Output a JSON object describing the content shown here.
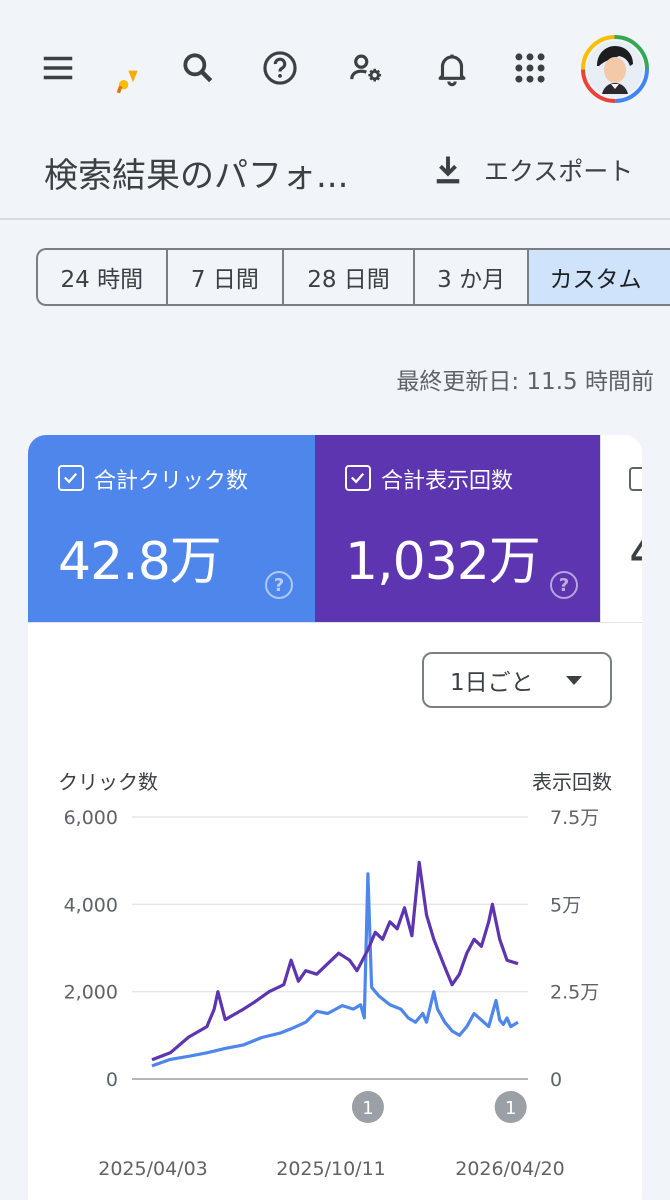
{
  "toolbar": {
    "icons": [
      "menu-icon",
      "search-console-logo",
      "search-icon",
      "help-icon",
      "manage-users-icon",
      "notifications-icon",
      "apps-icon",
      "account-avatar"
    ]
  },
  "header": {
    "title": "検索結果のパフォ...",
    "export_label": "エクスポート"
  },
  "date_range": {
    "tabs": [
      {
        "label": "24 時間",
        "active": false
      },
      {
        "label": "7 日間",
        "active": false
      },
      {
        "label": "28 日間",
        "active": false
      },
      {
        "label": "3 か月",
        "active": false
      },
      {
        "label": "カスタム",
        "active": true
      }
    ]
  },
  "last_updated": "最終更新日: 11.5 時間前",
  "metrics": [
    {
      "label": "合計クリック数",
      "value": "42.8万",
      "checked": true,
      "color": "#4f86ec"
    },
    {
      "label": "合計表示回数",
      "value": "1,032万",
      "checked": true,
      "color": "#5e35b1"
    },
    {
      "label": "",
      "value": "4",
      "checked": false
    }
  ],
  "granularity": {
    "selected": "1日ごと"
  },
  "chart_data": {
    "type": "line",
    "left_axis": {
      "label": "クリック数",
      "ticks": [
        "6,000",
        "4,000",
        "2,000",
        "0"
      ],
      "ylim": [
        0,
        6000
      ]
    },
    "right_axis": {
      "label": "表示回数",
      "ticks": [
        "7.5万",
        "5万",
        "2.5万",
        "0"
      ],
      "ylim": [
        0,
        75000
      ]
    },
    "x_ticks": [
      "2025/04/03",
      "2025/10/11",
      "2026/04/20"
    ],
    "x_range": [
      0,
      1
    ],
    "annotations": [
      {
        "text": "1",
        "x": 0.59
      },
      {
        "text": "1",
        "x": 0.98
      }
    ],
    "series": [
      {
        "name": "合計クリック数",
        "axis": "left",
        "color": "#4f86ec",
        "points": [
          [
            0.0,
            300
          ],
          [
            0.05,
            450
          ],
          [
            0.1,
            520
          ],
          [
            0.15,
            600
          ],
          [
            0.2,
            700
          ],
          [
            0.25,
            780
          ],
          [
            0.3,
            950
          ],
          [
            0.35,
            1050
          ],
          [
            0.38,
            1150
          ],
          [
            0.42,
            1300
          ],
          [
            0.45,
            1550
          ],
          [
            0.48,
            1500
          ],
          [
            0.52,
            1680
          ],
          [
            0.55,
            1600
          ],
          [
            0.57,
            1700
          ],
          [
            0.58,
            1400
          ],
          [
            0.59,
            4700
          ],
          [
            0.6,
            2100
          ],
          [
            0.62,
            1900
          ],
          [
            0.65,
            1700
          ],
          [
            0.68,
            1600
          ],
          [
            0.7,
            1400
          ],
          [
            0.72,
            1300
          ],
          [
            0.74,
            1500
          ],
          [
            0.75,
            1300
          ],
          [
            0.77,
            2000
          ],
          [
            0.78,
            1600
          ],
          [
            0.8,
            1300
          ],
          [
            0.82,
            1100
          ],
          [
            0.84,
            1000
          ],
          [
            0.86,
            1200
          ],
          [
            0.88,
            1500
          ],
          [
            0.9,
            1350
          ],
          [
            0.92,
            1200
          ],
          [
            0.94,
            1800
          ],
          [
            0.95,
            1350
          ],
          [
            0.96,
            1250
          ],
          [
            0.97,
            1400
          ],
          [
            0.98,
            1200
          ],
          [
            1.0,
            1300
          ]
        ]
      },
      {
        "name": "合計表示回数",
        "axis": "right",
        "color": "#5e35b1",
        "points": [
          [
            0.0,
            5500
          ],
          [
            0.05,
            7500
          ],
          [
            0.1,
            12000
          ],
          [
            0.15,
            15000
          ],
          [
            0.17,
            20000
          ],
          [
            0.18,
            25000
          ],
          [
            0.2,
            17000
          ],
          [
            0.25,
            20000
          ],
          [
            0.28,
            22000
          ],
          [
            0.32,
            25000
          ],
          [
            0.36,
            27000
          ],
          [
            0.38,
            34000
          ],
          [
            0.4,
            28000
          ],
          [
            0.42,
            31000
          ],
          [
            0.45,
            30000
          ],
          [
            0.48,
            33000
          ],
          [
            0.51,
            36000
          ],
          [
            0.54,
            34000
          ],
          [
            0.56,
            31000
          ],
          [
            0.59,
            37000
          ],
          [
            0.61,
            42000
          ],
          [
            0.63,
            40000
          ],
          [
            0.65,
            45000
          ],
          [
            0.67,
            43000
          ],
          [
            0.69,
            49000
          ],
          [
            0.71,
            41000
          ],
          [
            0.73,
            62000
          ],
          [
            0.75,
            47000
          ],
          [
            0.77,
            40000
          ],
          [
            0.8,
            32000
          ],
          [
            0.82,
            27000
          ],
          [
            0.84,
            30000
          ],
          [
            0.86,
            36000
          ],
          [
            0.88,
            40000
          ],
          [
            0.9,
            38000
          ],
          [
            0.92,
            45000
          ],
          [
            0.93,
            50000
          ],
          [
            0.95,
            40000
          ],
          [
            0.97,
            34000
          ],
          [
            1.0,
            33000
          ]
        ]
      }
    ]
  }
}
